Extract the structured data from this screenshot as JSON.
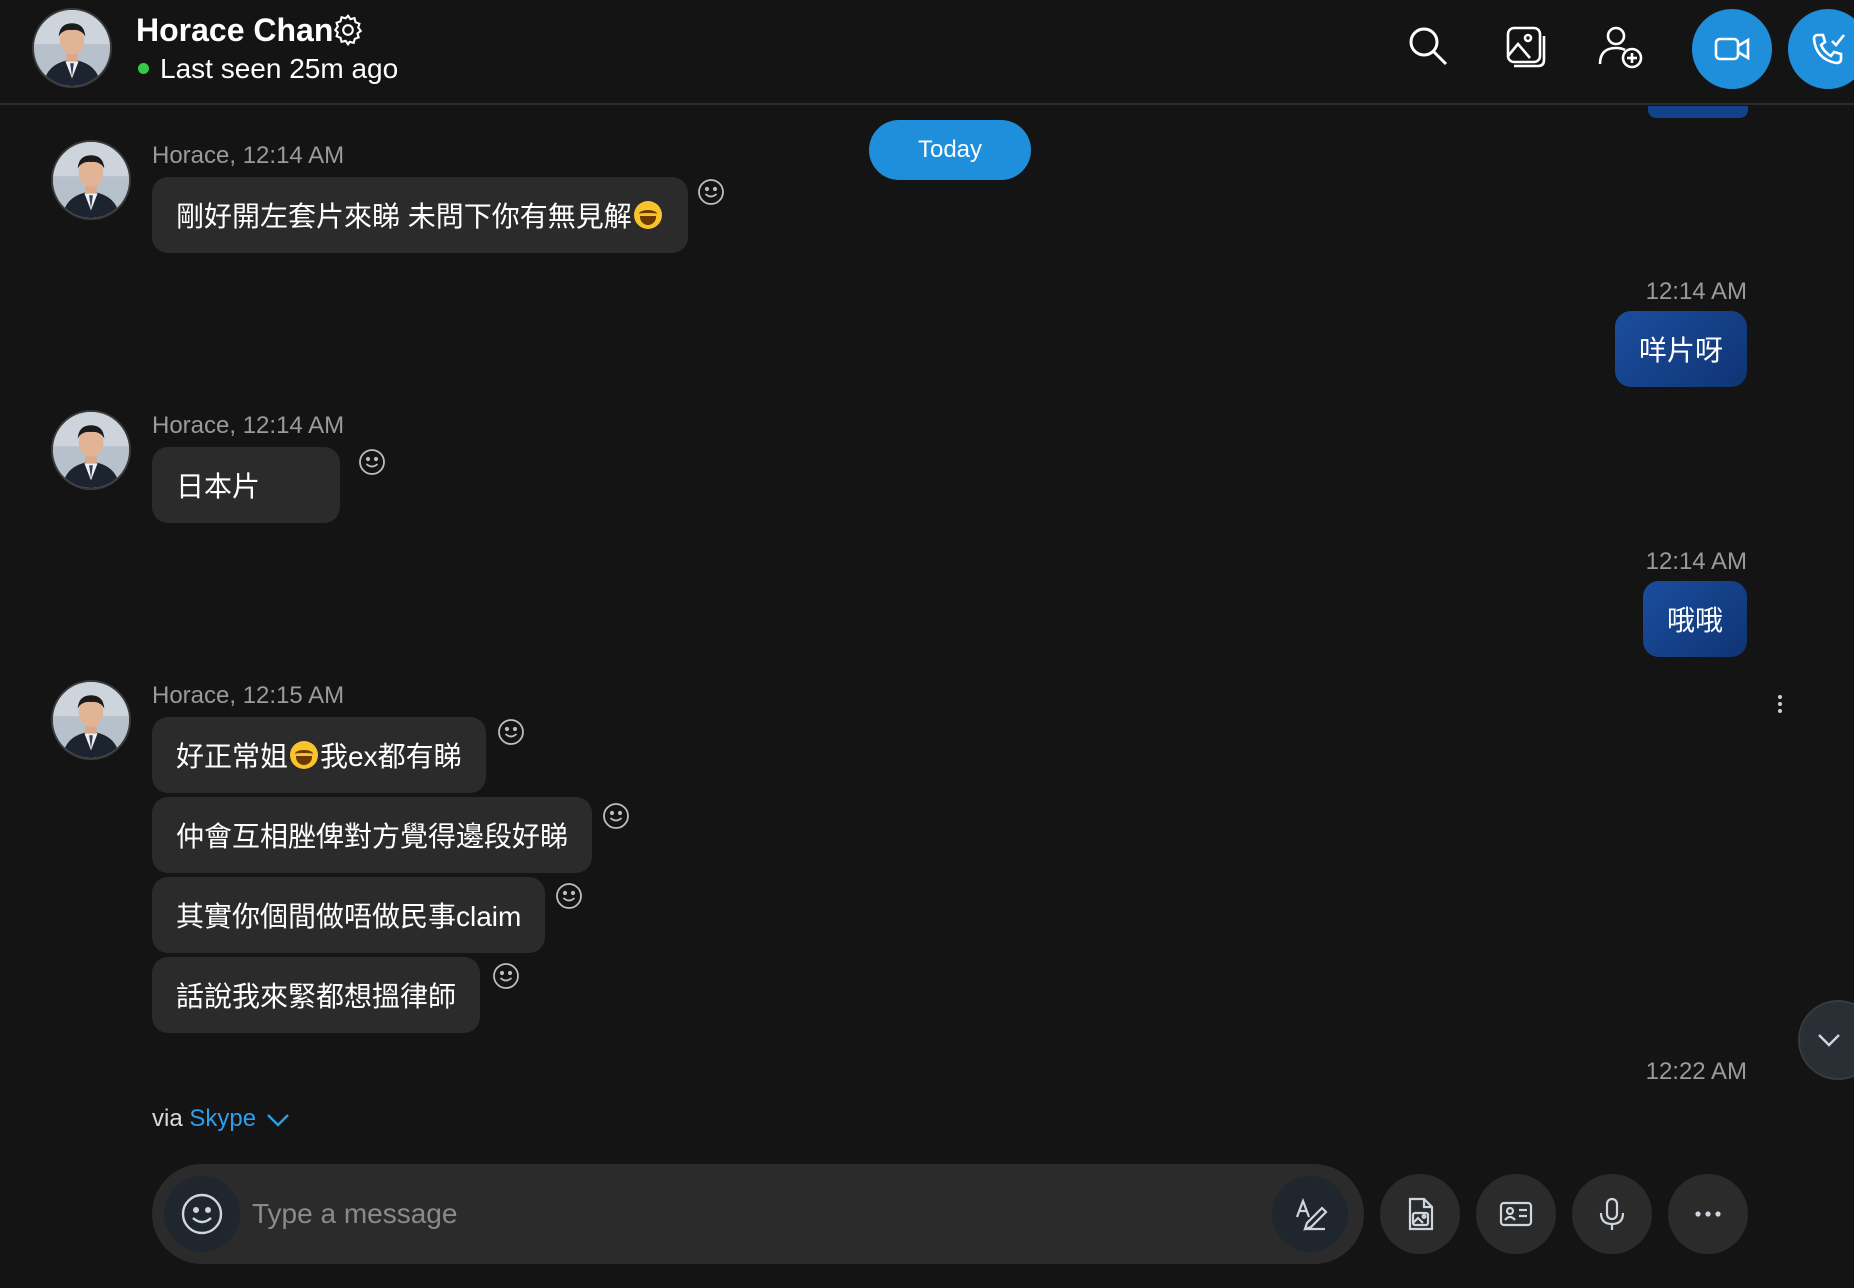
{
  "header": {
    "contact_name": "Horace Chan",
    "status": "Last seen 25m ago",
    "presence_color": "#37c84a",
    "icons": [
      "settings-icon",
      "search-icon",
      "gallery-icon",
      "add-people-icon",
      "video-call-icon",
      "audio-call-icon"
    ]
  },
  "conversation": {
    "date_divider": "Today",
    "messages": [
      {
        "direction": "incoming",
        "sender_line": "Horace, 12:14 AM",
        "bubbles": [
          {
            "text": "剛好開左套片來睇 未問下你有無見解",
            "trailing_emoji": "face-with-tears-of-joy"
          }
        ]
      },
      {
        "direction": "outgoing",
        "time": "12:14 AM",
        "bubbles": [
          {
            "text": "咩片呀"
          }
        ]
      },
      {
        "direction": "incoming",
        "sender_line": "Horace, 12:14 AM",
        "bubbles": [
          {
            "text": "日本片"
          }
        ]
      },
      {
        "direction": "outgoing",
        "time": "12:14 AM",
        "bubbles": [
          {
            "text": "哦哦"
          }
        ]
      },
      {
        "direction": "incoming",
        "sender_line": "Horace, 12:15 AM",
        "bubbles": [
          {
            "text_before": "好正常姐",
            "emoji": "face-with-tears-of-joy",
            "text_after": "我ex都有睇"
          },
          {
            "text": "仲會互相脞俾對方覺得邊段好睇"
          },
          {
            "text": "其實你個間做唔做民事claim"
          },
          {
            "text": "話說我來緊都想搵律師"
          }
        ]
      }
    ],
    "last_time": "12:22 AM",
    "via_prefix": "via ",
    "via_link": "Skype"
  },
  "composer": {
    "placeholder": "Type a message",
    "value": "",
    "icons": [
      "emoji-icon",
      "format-text-icon",
      "file-upload-icon",
      "contact-card-icon",
      "microphone-icon",
      "more-icon"
    ]
  },
  "colors": {
    "background": "#141414",
    "accent": "#1f8fdb",
    "incoming_bubble": "#2b2b2b",
    "outgoing_bubble": "#1b4d9e",
    "muted_text": "#9a9a9a",
    "link": "#2f9de8"
  }
}
